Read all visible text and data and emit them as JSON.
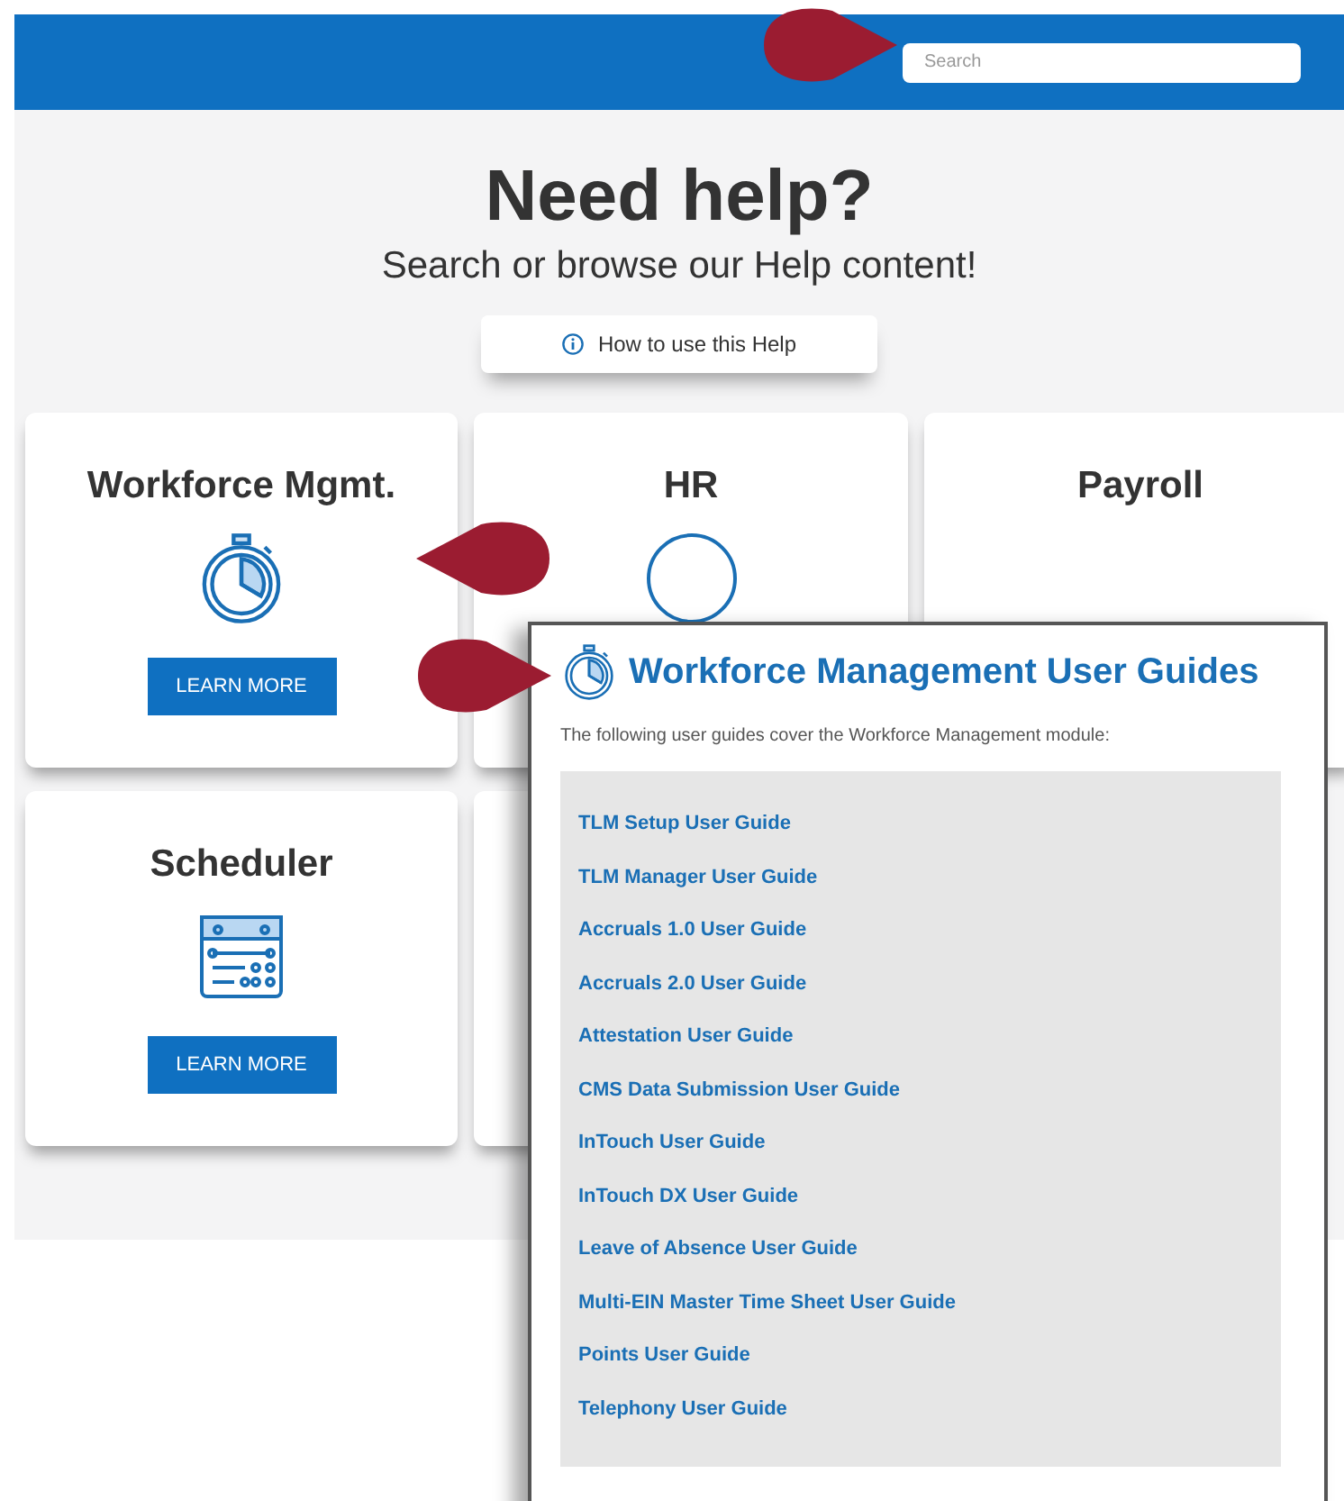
{
  "header": {
    "search": {
      "placeholder": "Search"
    }
  },
  "hero": {
    "title": "Need help?",
    "subtitle": "Search or browse our Help content!",
    "help_button": "How to use this Help"
  },
  "cards": [
    {
      "kind": "stopwatch",
      "title": "Workforce Mgmt.",
      "button": "LEARN MORE"
    },
    {
      "kind": "circle",
      "title": "HR"
    },
    {
      "kind": "plain",
      "title": "Payroll"
    },
    {
      "kind": "calendar",
      "title": "Scheduler",
      "button": "LEARN MORE"
    },
    {
      "kind": "blank"
    }
  ],
  "panel": {
    "title": "Workforce Management User Guides",
    "intro": "The following user guides cover the Workforce Management module:",
    "links": [
      "TLM Setup User Guide",
      "TLM Manager User Guide",
      "Accruals 1.0 User Guide",
      "Accruals 2.0 User Guide",
      "Attestation User Guide",
      "CMS Data Submission User Guide",
      "InTouch User Guide",
      "InTouch DX User Guide",
      "Leave of Absence User Guide",
      "Multi-EIN Master Time Sheet User Guide",
      "Points User Guide",
      "Telephony User Guide"
    ]
  }
}
